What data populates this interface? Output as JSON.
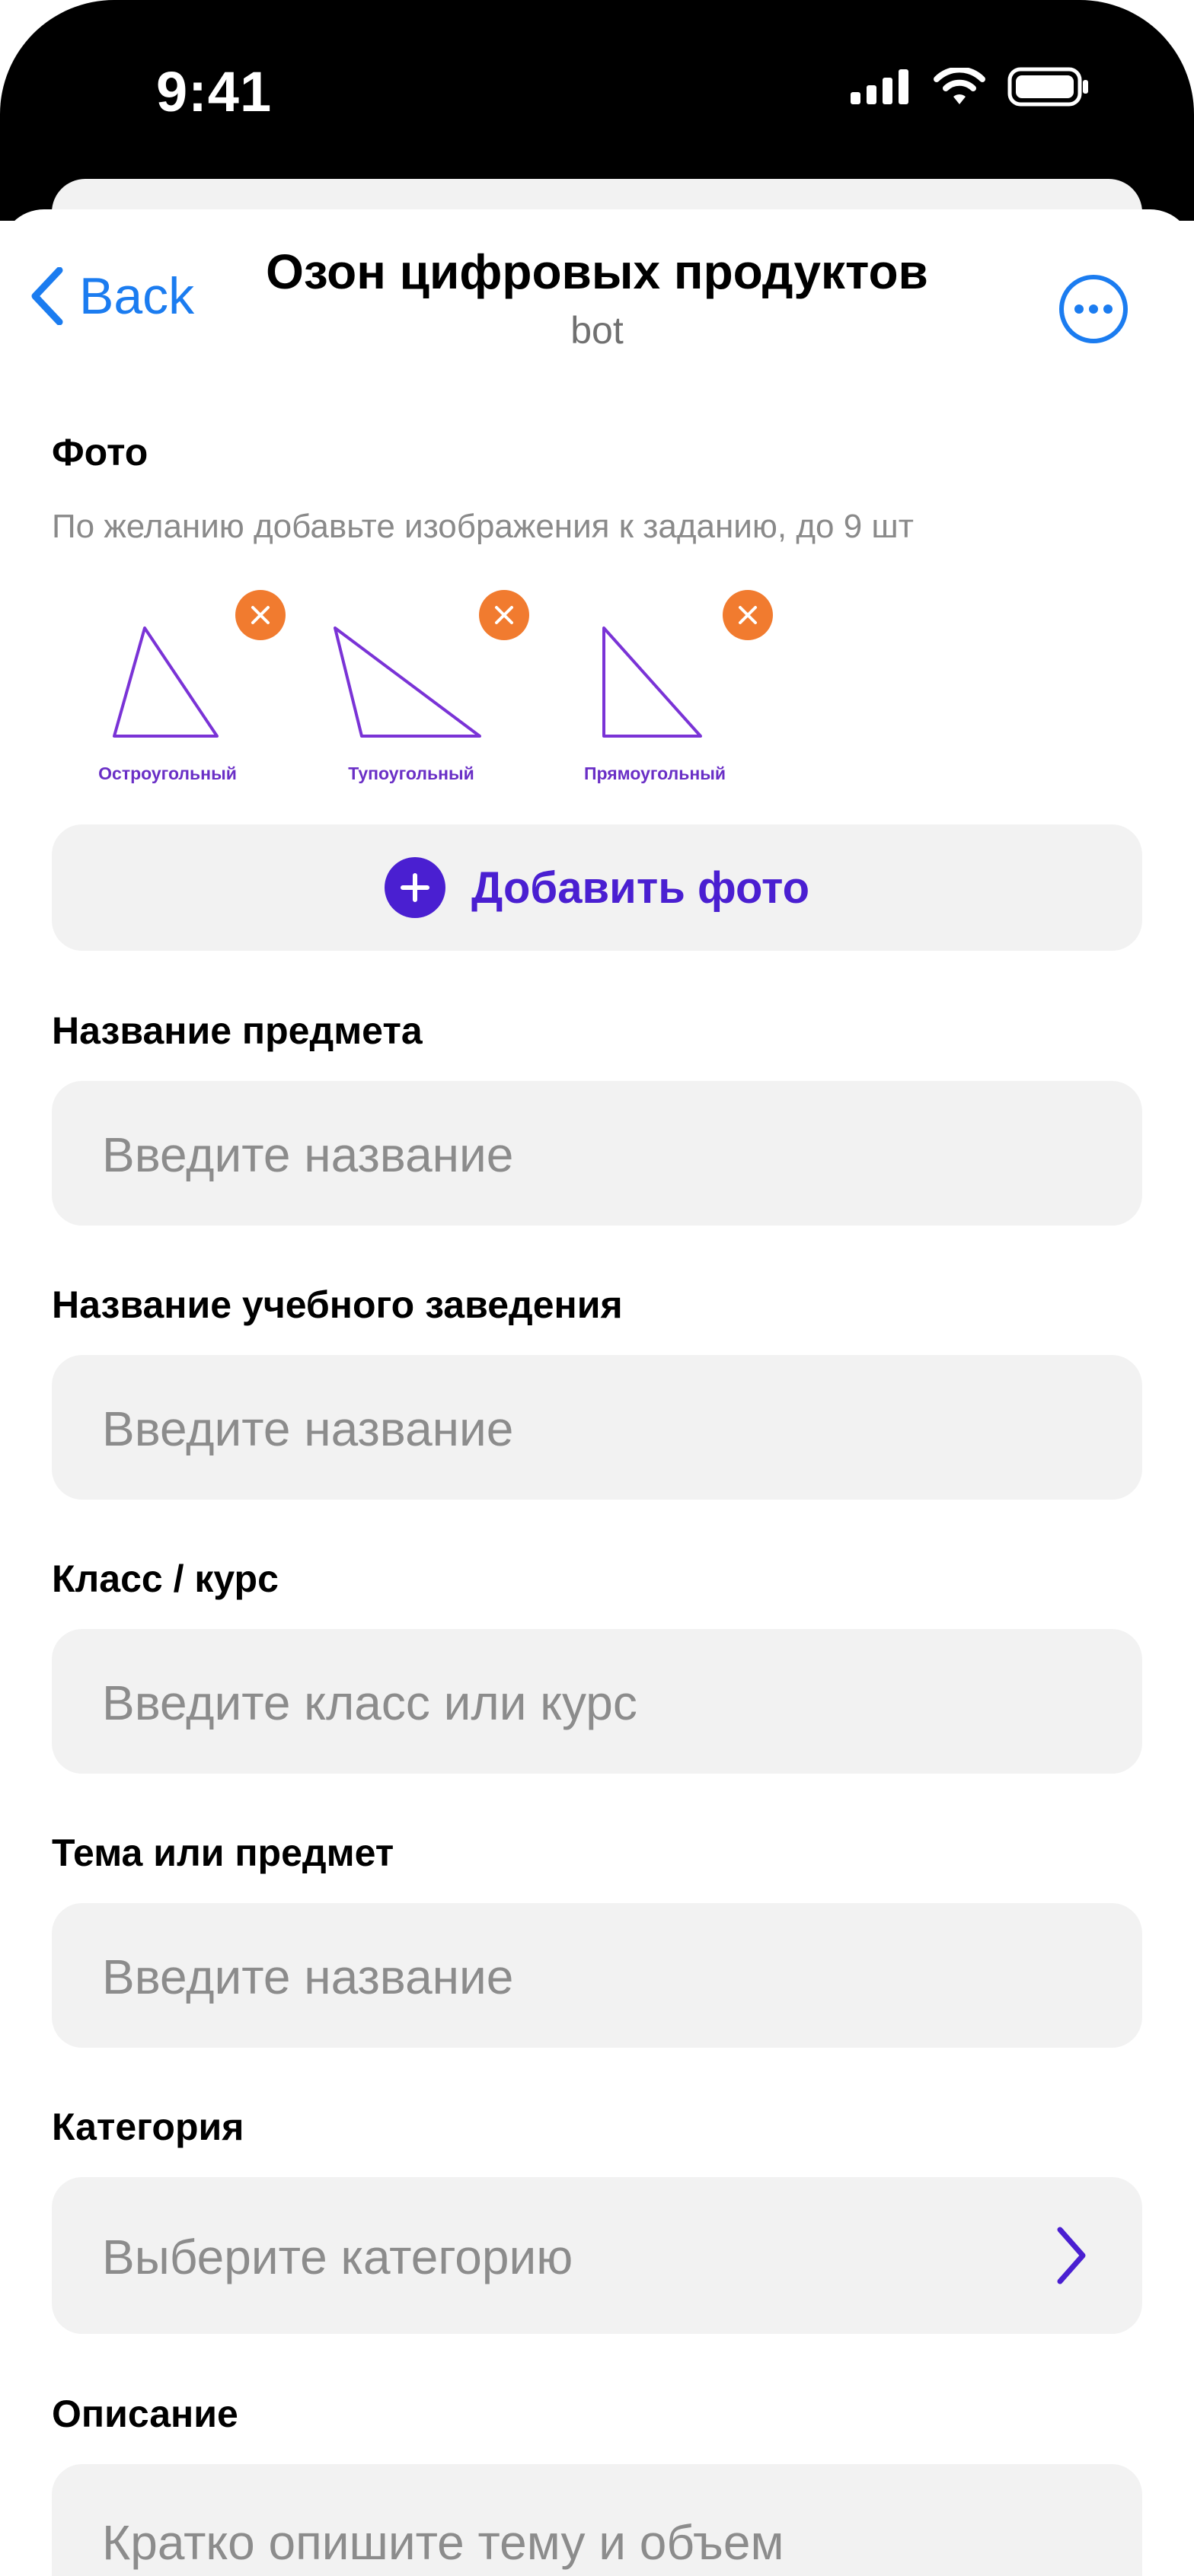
{
  "status_bar": {
    "time": "9:41"
  },
  "nav": {
    "back_label": "Back",
    "title": "Озон цифровых продуктов",
    "subtitle": "bot"
  },
  "photo": {
    "label": "Фото",
    "hint": "По желанию добавьте изображения к заданию, до 9 шт",
    "items": [
      {
        "caption": "Остроугольный"
      },
      {
        "caption": "Тупоугольный"
      },
      {
        "caption": "Прямоугольный"
      }
    ],
    "add_label": "Добавить фото"
  },
  "fields": [
    {
      "label": "Название предмета",
      "placeholder": "Введите название"
    },
    {
      "label": "Название учебного заведения",
      "placeholder": "Введите название"
    },
    {
      "label": "Класс / курс",
      "placeholder": "Введите класс или курс"
    },
    {
      "label": "Тема или предмет",
      "placeholder": "Введите название"
    },
    {
      "label": "Категория",
      "placeholder": "Выберите категорию"
    },
    {
      "label": "Описание",
      "placeholder": "Кратко опишите тему и объем"
    }
  ],
  "colors": {
    "accent": "#4a1fd1",
    "link": "#1b7cf0",
    "remove": "#f17b2f",
    "field_bg": "#f2f2f2"
  }
}
